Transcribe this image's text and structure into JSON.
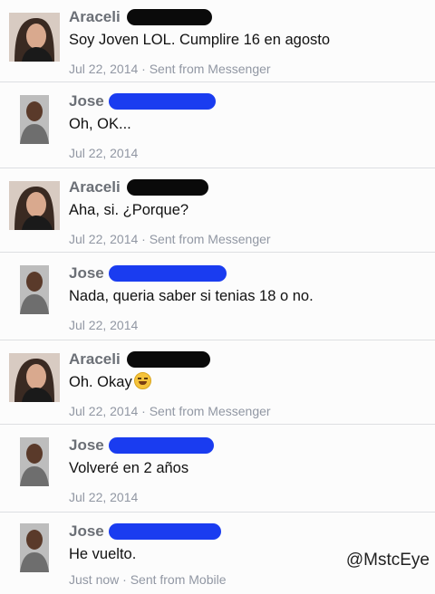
{
  "messages": [
    {
      "sender": "Araceli",
      "text": "Soy Joven LOL. Cumplire 16 en agosto",
      "meta": "Jul 22, 2014 · Sent from Messenger"
    },
    {
      "sender": "Jose",
      "text": "Oh, OK...",
      "meta": "Jul 22, 2014"
    },
    {
      "sender": "Araceli",
      "text": "Aha, si. ¿Porque?",
      "meta": "Jul 22, 2014 · Sent from Messenger"
    },
    {
      "sender": "Jose",
      "text": "Nada, queria saber si tenias 18 o no.",
      "meta": "Jul 22, 2014"
    },
    {
      "sender": "Araceli",
      "text": "Oh. Okay",
      "meta": "Jul 22, 2014 · Sent from Messenger",
      "emoji": "laughing-emoji"
    },
    {
      "sender": "Jose",
      "text": "Volveré en 2 años",
      "meta": "Jul 22, 2014"
    },
    {
      "sender": "Jose",
      "text": "He vuelto.",
      "meta": "Just now · Sent from Mobile"
    }
  ],
  "watermark": "@MstcEye",
  "colors": {
    "redaction_black": "#0a0a0a",
    "redaction_blue": "#1a3cf0",
    "sender": "#6b6f76",
    "meta": "#9197a3"
  }
}
